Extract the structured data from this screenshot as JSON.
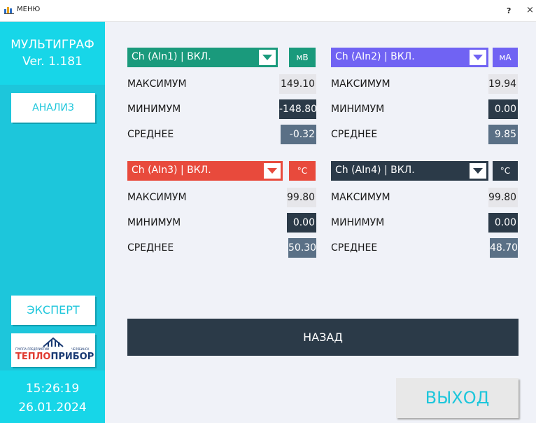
{
  "window": {
    "title": "МЕНЮ",
    "help": "?",
    "close": "×"
  },
  "sidebar": {
    "brand_name": "МУЛЬТИГРАФ",
    "version": "Ver. 1.181",
    "analysis_label": "АНАЛИЗ",
    "expert_label": "ЭКСПЕРТ",
    "logo": {
      "tagline_left": "ГРУППА ПРЕДПРИЯТИЙ",
      "tagline_right": "ЧЕЛЯБИНСК",
      "word_red": "ТЕПЛО",
      "word_blue": "ПРИБОР"
    },
    "time": "15:26:19",
    "date": "26.01.2024"
  },
  "labels": {
    "max": "МАКСИМУМ",
    "min": "МИНИМУМ",
    "avg": "СРЕДНЕЕ"
  },
  "channels": [
    {
      "name": "Ch (AIn1) | ВКЛ.",
      "unit": "мВ",
      "color": "#1a9a7c",
      "max": "149.10",
      "min": "-148.80",
      "avg": "-0.32"
    },
    {
      "name": "Ch (AIn2) | ВКЛ.",
      "unit": "мА",
      "color": "#7063f3",
      "max": "19.94",
      "min": "0.00",
      "avg": "9.85"
    },
    {
      "name": "Ch (AIn3) | ВКЛ.",
      "unit": "°C",
      "color": "#e84a3c",
      "max": "99.80",
      "min": "0.00",
      "avg": "50.30"
    },
    {
      "name": "Ch (AIn4) | ВКЛ.",
      "unit": "°C",
      "color": "#2b3a48",
      "max": "99.80",
      "min": "0.00",
      "avg": "48.70"
    }
  ],
  "buttons": {
    "back": "НАЗАД",
    "exit": "ВЫХОД"
  }
}
